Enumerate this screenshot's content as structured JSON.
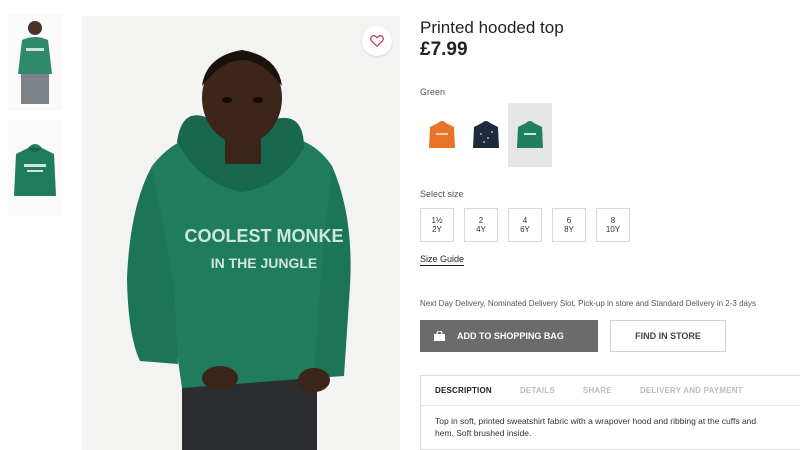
{
  "product": {
    "title": "Printed hooded top",
    "price": "£7.99",
    "color_label": "Green",
    "print_text_line1": "COOLEST MONKE",
    "print_text_line2": "IN THE JUNGLE",
    "print_text_line1_color": "#cfe6dc"
  },
  "swatches": [
    {
      "name": "orange",
      "color": "#e8742c"
    },
    {
      "name": "navy",
      "color": "#1f2a3d"
    },
    {
      "name": "green",
      "color": "#1f8060",
      "selected": true
    }
  ],
  "sizes": {
    "label": "Select size",
    "options": [
      {
        "top": "1½",
        "bottom": "2Y"
      },
      {
        "top": "2",
        "bottom": "4Y"
      },
      {
        "top": "4",
        "bottom": "6Y"
      },
      {
        "top": "6",
        "bottom": "8Y"
      },
      {
        "top": "8",
        "bottom": "10Y"
      }
    ],
    "guide_label": "Size Guide"
  },
  "delivery_text": "Next Day Delivery, Nominated Delivery Slot, Pick-up in store and Standard Delivery in 2-3 days",
  "actions": {
    "add_to_bag": "ADD TO SHOPPING BAG",
    "find_in_store": "FIND IN STORE"
  },
  "tabs": [
    "DESCRIPTION",
    "DETAILS",
    "SHARE",
    "DELIVERY AND PAYMENT"
  ],
  "description": "Top in soft, printed sweatshirt fabric with a wrapover hood and ribbing at the cuffs and hem. Soft brushed inside.",
  "colors": {
    "hoodie_green": "#1f7d5e",
    "button_grey": "#6b6b6b"
  }
}
